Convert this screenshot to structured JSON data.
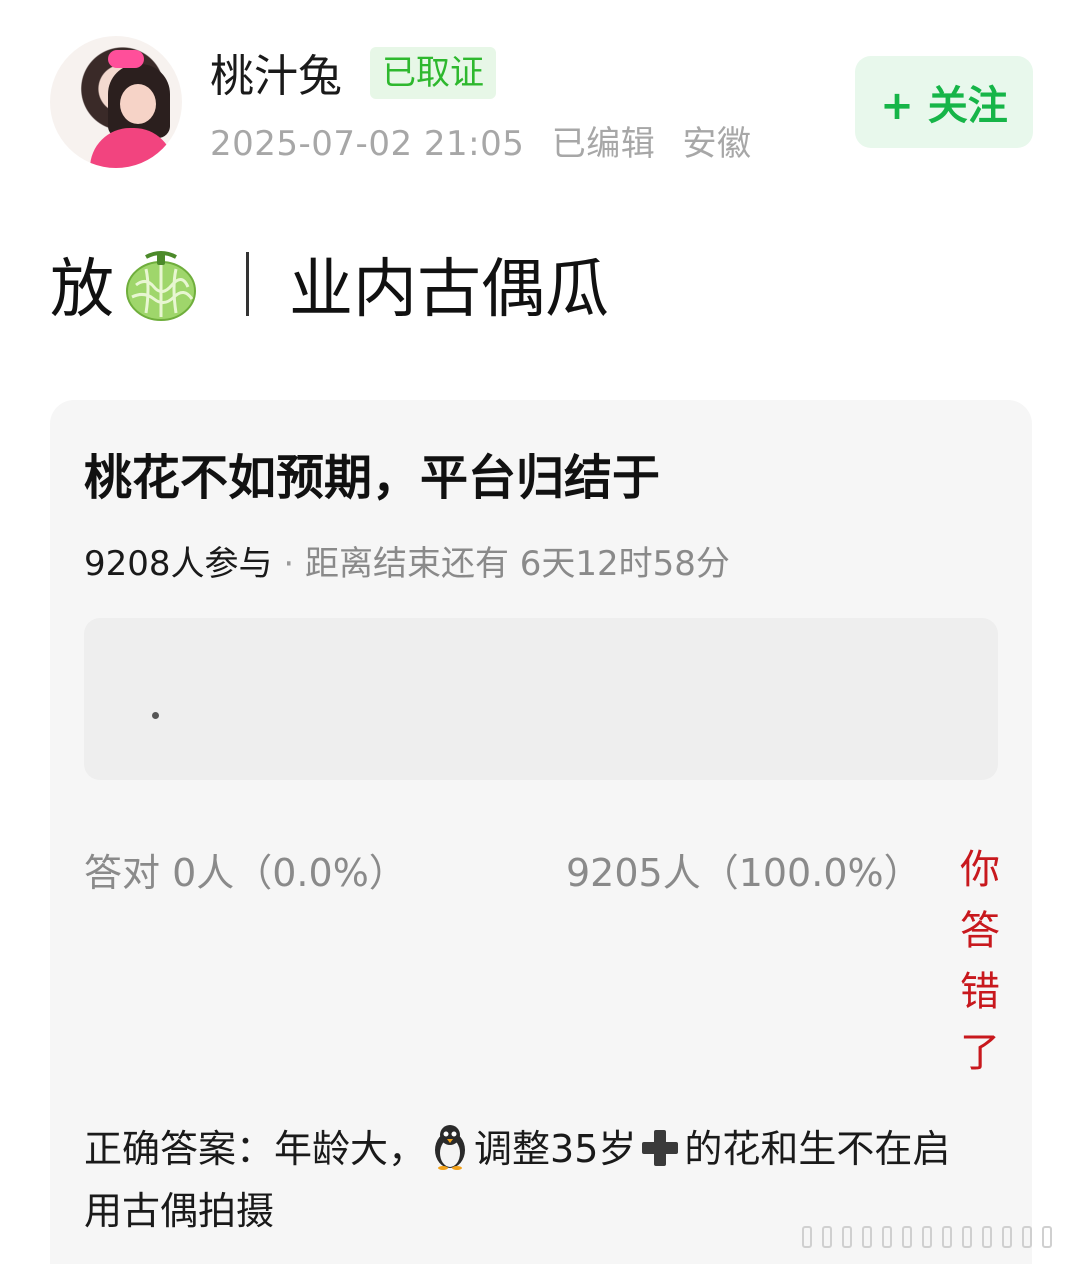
{
  "author": {
    "name": "桃汁兔",
    "badge": "已取证",
    "timestamp": "2025-07-02 21:05",
    "edited": "已编辑",
    "location": "安徽"
  },
  "follow": {
    "label": "+ 关注"
  },
  "headline": {
    "prefix": "放",
    "emoji": "melon-icon",
    "topic": "业内古偶瓜"
  },
  "poll": {
    "question": "桃花不如预期，平台归结于",
    "participants": "9208人参与",
    "separator": "·",
    "countdown": "距离结束还有 6天12时58分",
    "correct_stat": "答对  0人（0.0%）",
    "wrong_stat": "9205人（100.0%）",
    "result_chars": [
      "你",
      "答",
      "错",
      "了"
    ],
    "answer_prefix": "正确答案：年龄大，",
    "answer_mid": "调整35岁",
    "answer_suffix": "的花和生不在启用古偶拍摄"
  },
  "colors": {
    "badge_green": "#2eb82e",
    "follow_green": "#16b548",
    "wrong_red": "#c8181d",
    "card_bg": "#f6f6f6"
  }
}
